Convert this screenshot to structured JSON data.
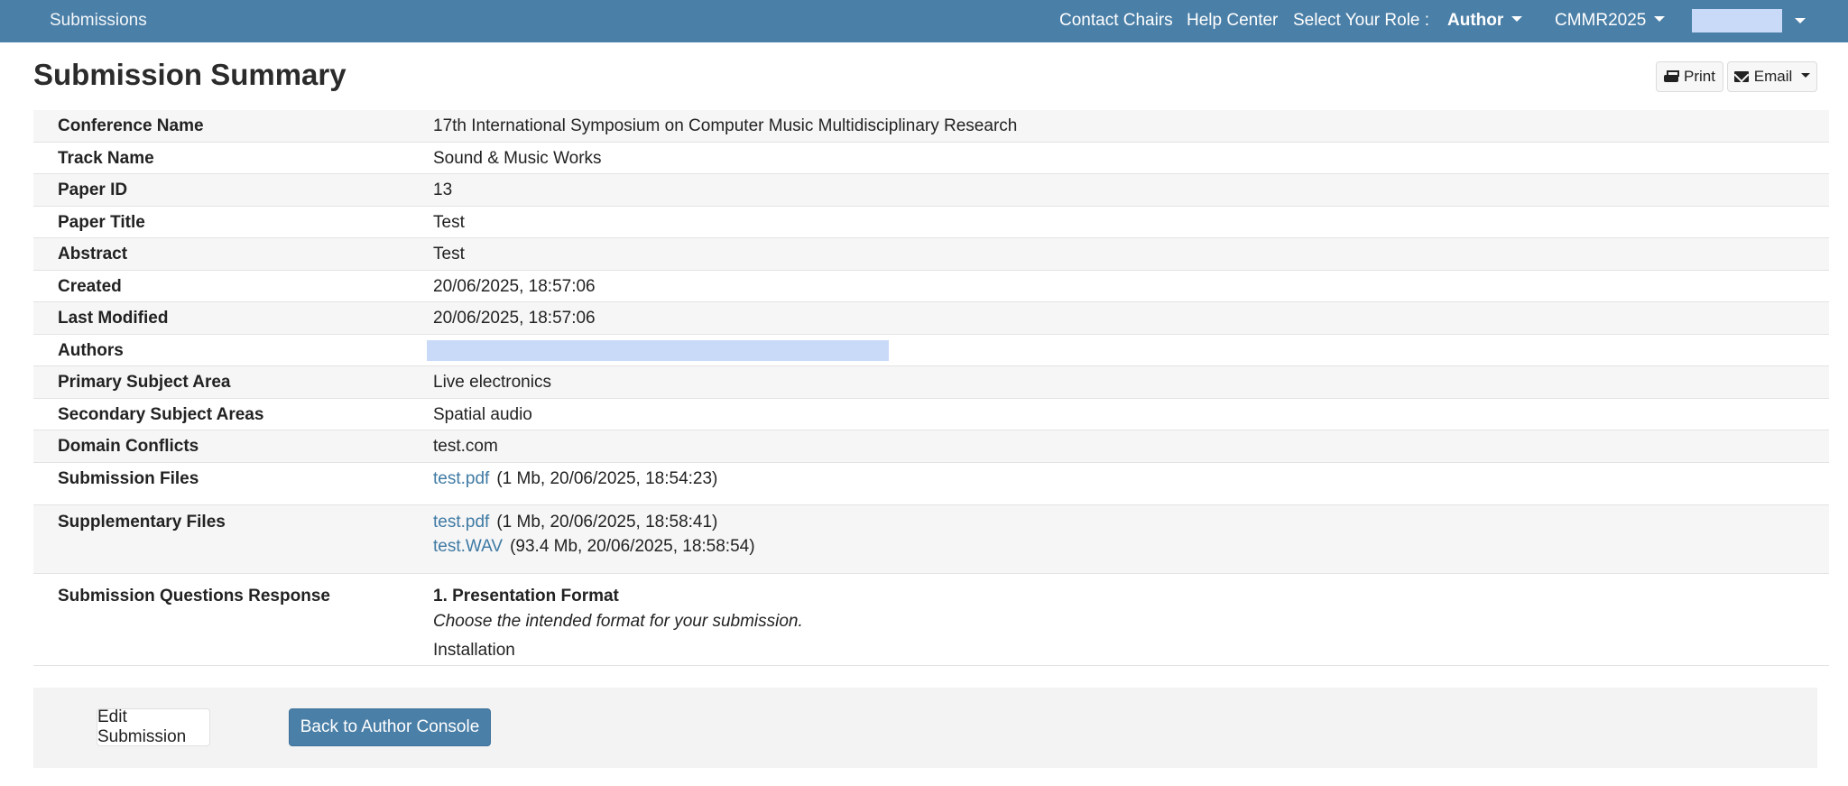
{
  "nav": {
    "brand": "Submissions",
    "contact_chairs": "Contact Chairs",
    "help_center": "Help Center",
    "select_role_label": "Select Your Role :",
    "role_value": "Author",
    "conference_short": "CMMR2025"
  },
  "page": {
    "title": "Submission Summary",
    "print_label": "Print",
    "email_label": "Email"
  },
  "summary": {
    "conference_name": {
      "label": "Conference Name",
      "value": "17th International Symposium on Computer Music Multidisciplinary Research"
    },
    "track_name": {
      "label": "Track Name",
      "value": "Sound & Music Works"
    },
    "paper_id": {
      "label": "Paper ID",
      "value": "13"
    },
    "paper_title": {
      "label": "Paper Title",
      "value": "Test"
    },
    "abstract": {
      "label": "Abstract",
      "value": "Test"
    },
    "created": {
      "label": "Created",
      "value": "20/06/2025, 18:57:06"
    },
    "last_modified": {
      "label": "Last Modified",
      "value": "20/06/2025, 18:57:06"
    },
    "authors": {
      "label": "Authors"
    },
    "primary_subject": {
      "label": "Primary Subject Area",
      "value": "Live electronics"
    },
    "secondary_subjects": {
      "label": "Secondary Subject Areas",
      "value": "Spatial audio"
    },
    "domain_conflicts": {
      "label": "Domain Conflicts",
      "value": "test.com"
    },
    "submission_files": {
      "label": "Submission Files",
      "files": [
        {
          "name": "test.pdf",
          "meta": "(1 Mb, 20/06/2025, 18:54:23)"
        }
      ]
    },
    "supplementary_files": {
      "label": "Supplementary Files",
      "files": [
        {
          "name": "test.pdf",
          "meta": "(1 Mb, 20/06/2025, 18:58:41)"
        },
        {
          "name": "test.WAV",
          "meta": "(93.4 Mb, 20/06/2025, 18:58:54)"
        }
      ]
    },
    "questions": {
      "label": "Submission Questions Response",
      "q1_title": "1. Presentation Format",
      "q1_help": "Choose the intended format for your submission.",
      "q1_answer": "Installation"
    }
  },
  "footer": {
    "edit_label": "Edit Submission",
    "back_label": "Back to Author Console"
  },
  "colors": {
    "navbar": "#4a7fa7",
    "link": "#3f7aa3",
    "redaction": "#c9daf8"
  }
}
